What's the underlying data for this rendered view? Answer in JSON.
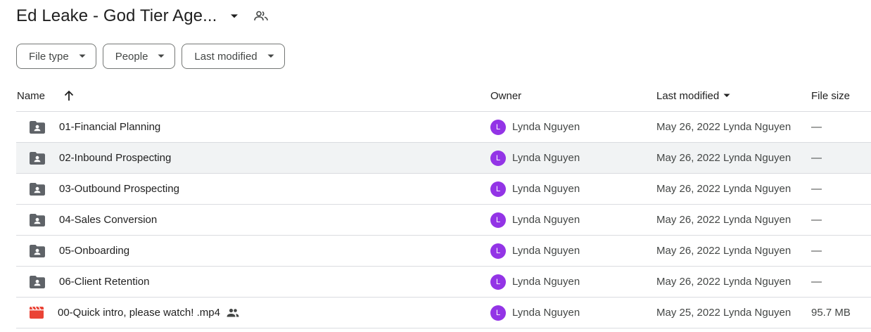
{
  "header": {
    "title": "Ed Leake - God Tier Age...",
    "share_icon": "shared-people-icon"
  },
  "filters": [
    {
      "label": "File type"
    },
    {
      "label": "People"
    },
    {
      "label": "Last modified"
    }
  ],
  "columns": {
    "name": "Name",
    "owner": "Owner",
    "last_modified": "Last modified",
    "file_size": "File size"
  },
  "rows": [
    {
      "name": "01-Financial Planning",
      "icon": "shared-folder-icon",
      "owner_initial": "L",
      "owner": "Lynda Nguyen",
      "modified": "May 26, 2022 Lynda Nguyen",
      "size": "—",
      "highlight": false
    },
    {
      "name": "02-Inbound Prospecting",
      "icon": "shared-folder-icon",
      "owner_initial": "L",
      "owner": "Lynda Nguyen",
      "modified": "May 26, 2022 Lynda Nguyen",
      "size": "—",
      "highlight": true
    },
    {
      "name": "03-Outbound Prospecting",
      "icon": "shared-folder-icon",
      "owner_initial": "L",
      "owner": "Lynda Nguyen",
      "modified": "May 26, 2022 Lynda Nguyen",
      "size": "—",
      "highlight": false
    },
    {
      "name": "04-Sales Conversion",
      "icon": "shared-folder-icon",
      "owner_initial": "L",
      "owner": "Lynda Nguyen",
      "modified": "May 26, 2022 Lynda Nguyen",
      "size": "—",
      "highlight": false
    },
    {
      "name": "05-Onboarding",
      "icon": "shared-folder-icon",
      "owner_initial": "L",
      "owner": "Lynda Nguyen",
      "modified": "May 26, 2022 Lynda Nguyen",
      "size": "—",
      "highlight": false
    },
    {
      "name": "06-Client Retention",
      "icon": "shared-folder-icon",
      "owner_initial": "L",
      "owner": "Lynda Nguyen",
      "modified": "May 26, 2022 Lynda Nguyen",
      "size": "—",
      "highlight": false
    },
    {
      "name": "00-Quick intro, please watch! .mp4",
      "icon": "video-file-icon",
      "shared": true,
      "owner_initial": "L",
      "owner": "Lynda Nguyen",
      "modified": "May 25, 2022 Lynda Nguyen",
      "size": "95.7 MB",
      "highlight": false
    }
  ],
  "colors": {
    "avatar": "#9334e6",
    "folder": "#5f6368",
    "video": "#ea4335",
    "row_highlight": "#f1f3f4"
  }
}
